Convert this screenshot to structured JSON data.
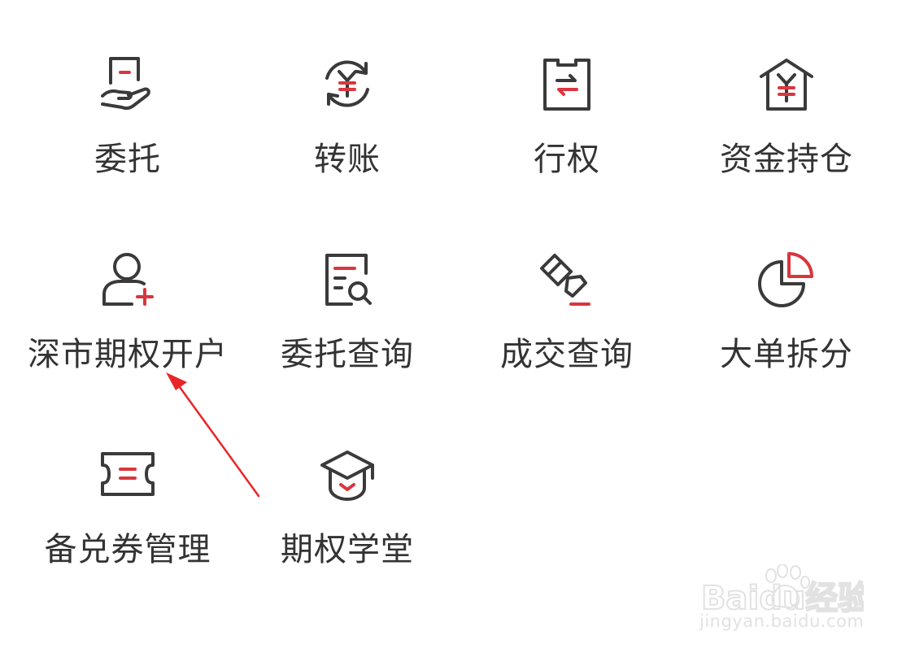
{
  "menu": {
    "items": [
      {
        "label": "委托",
        "icon": "hand-document-icon"
      },
      {
        "label": "转账",
        "icon": "yuan-transfer-icon"
      },
      {
        "label": "行权",
        "icon": "clipboard-exchange-icon"
      },
      {
        "label": "资金持仓",
        "icon": "yuan-house-icon"
      },
      {
        "label": "深市期权开户",
        "icon": "add-user-icon"
      },
      {
        "label": "委托查询",
        "icon": "document-search-icon"
      },
      {
        "label": "成交查询",
        "icon": "gavel-icon"
      },
      {
        "label": "大单拆分",
        "icon": "pie-chart-icon"
      },
      {
        "label": "备兑券管理",
        "icon": "ticket-icon"
      },
      {
        "label": "期权学堂",
        "icon": "graduation-cap-icon"
      }
    ]
  },
  "watermark": {
    "text": "Baidu经验",
    "url": "jingyan.baidu.com"
  },
  "colors": {
    "icon_stroke": "#3a3a3a",
    "accent": "#d9363e",
    "label": "#333333",
    "annotation_arrow": "#e8262a",
    "watermark": "#e2e2e2"
  }
}
